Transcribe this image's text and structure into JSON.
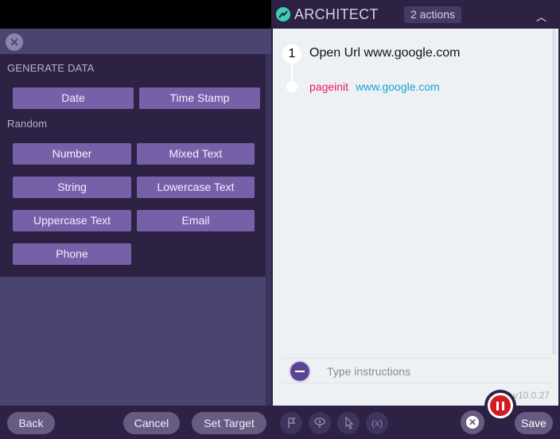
{
  "left_panel": {
    "close_icon": "close-icon",
    "generate_data_title": "GENERATE DATA",
    "buttons_top": [
      "Date",
      "Time Stamp"
    ],
    "random_title": "Random",
    "random_buttons": [
      "Number",
      "Mixed Text",
      "String",
      "Lowercase Text",
      "Uppercase Text",
      "Email",
      "Phone"
    ],
    "footer": {
      "back": "Back",
      "cancel": "Cancel",
      "set_target": "Set Target"
    }
  },
  "right_panel": {
    "brand": "ARCHITECT",
    "actions_count": "2 actions",
    "collapse_icon": "chevron-up-icon",
    "steps": [
      {
        "number": "1",
        "title": "Open Url www.google.com",
        "event": "pageinit",
        "url": "www.google.com"
      }
    ],
    "instructions_placeholder": "Type instructions",
    "version": "v10.0.27",
    "toolbar": {
      "tools": [
        "flag-icon",
        "eye-icon",
        "pointer-icon",
        "variable-icon"
      ],
      "variable_label": "(x)",
      "close_icon": "close-icon",
      "pause_icon": "pause-icon",
      "save_label": "Save"
    }
  },
  "colors": {
    "panel_dark": "#2d2244",
    "panel_mid": "#4a4470",
    "button_purple": "#7661a8",
    "pill": "#675b82",
    "event_red": "#e7185f",
    "link_blue": "#12a3d8",
    "record_red": "#d21c22"
  }
}
